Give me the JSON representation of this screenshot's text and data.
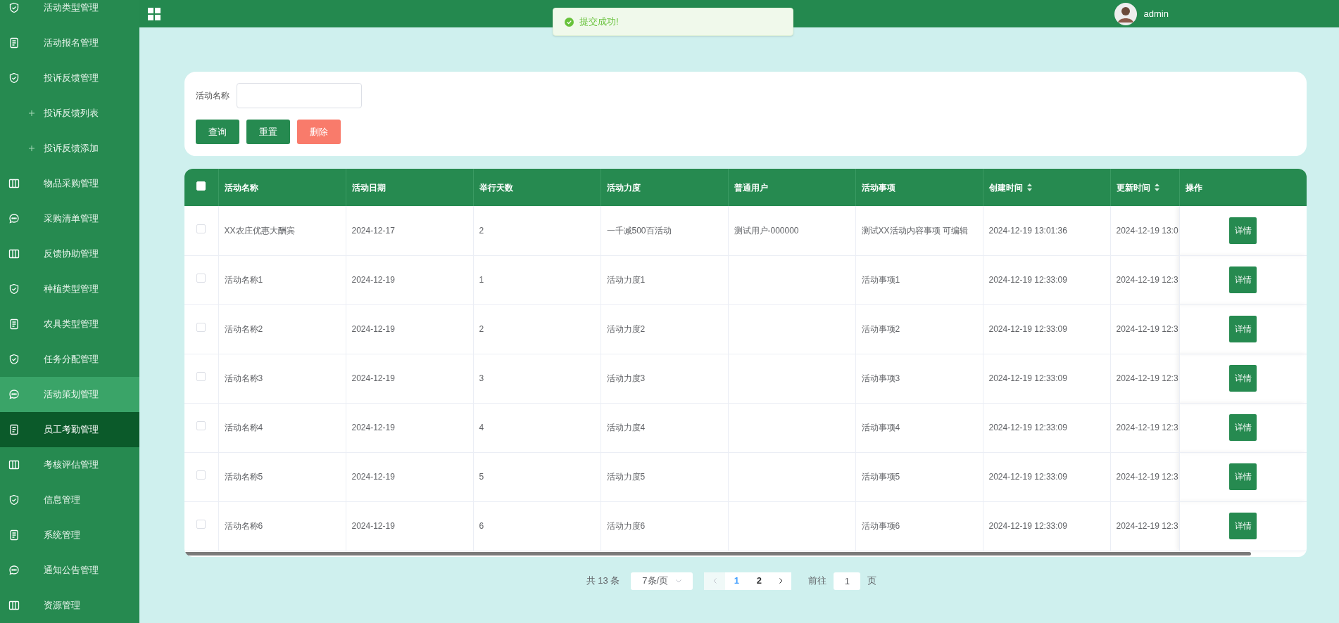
{
  "header": {
    "user": "admin"
  },
  "toast": {
    "message": "提交成功!"
  },
  "sidebar": {
    "items": [
      {
        "kind": "shield",
        "label": "活动类型管理",
        "selected": false,
        "hovered": false
      },
      {
        "kind": "doc",
        "label": "活动报名管理",
        "selected": false,
        "hovered": false
      },
      {
        "kind": "shield",
        "label": "投诉反馈管理",
        "selected": false,
        "hovered": false
      },
      {
        "kind": "sub",
        "label": "投诉反馈列表",
        "selected": false,
        "hovered": false
      },
      {
        "kind": "sub",
        "label": "投诉反馈添加",
        "selected": false,
        "hovered": false
      },
      {
        "kind": "columns",
        "label": "物品采购管理",
        "selected": false,
        "hovered": false
      },
      {
        "kind": "chat",
        "label": "采购清单管理",
        "selected": false,
        "hovered": false
      },
      {
        "kind": "columns",
        "label": "反馈协助管理",
        "selected": false,
        "hovered": false
      },
      {
        "kind": "shield",
        "label": "种植类型管理",
        "selected": false,
        "hovered": false
      },
      {
        "kind": "doc",
        "label": "农具类型管理",
        "selected": false,
        "hovered": false
      },
      {
        "kind": "shield",
        "label": "任务分配管理",
        "selected": false,
        "hovered": false
      },
      {
        "kind": "chat",
        "label": "活动策划管理",
        "selected": false,
        "hovered": true
      },
      {
        "kind": "doc",
        "label": "员工考勤管理",
        "selected": true,
        "hovered": false
      },
      {
        "kind": "columns",
        "label": "考核评估管理",
        "selected": false,
        "hovered": false
      },
      {
        "kind": "shield",
        "label": "信息管理",
        "selected": false,
        "hovered": false
      },
      {
        "kind": "doc",
        "label": "系统管理",
        "selected": false,
        "hovered": false
      },
      {
        "kind": "chat",
        "label": "通知公告管理",
        "selected": false,
        "hovered": false
      },
      {
        "kind": "columns",
        "label": "资源管理",
        "selected": false,
        "hovered": false
      }
    ]
  },
  "search": {
    "label": "活动名称",
    "buttons": [
      {
        "label": "查询",
        "kind": "primary"
      },
      {
        "label": "重置",
        "kind": "primary"
      },
      {
        "label": "删除",
        "kind": "danger"
      }
    ]
  },
  "table": {
    "select_all": {
      "checked": false
    },
    "columns": [
      {
        "label": "活动名称",
        "sortable": false
      },
      {
        "label": "活动日期",
        "sortable": false
      },
      {
        "label": "举行天数",
        "sortable": false
      },
      {
        "label": "活动力度",
        "sortable": false
      },
      {
        "label": "普通用户",
        "sortable": false
      },
      {
        "label": "活动事项",
        "sortable": false
      },
      {
        "label": "创建时间",
        "sortable": true
      },
      {
        "label": "更新时间",
        "sortable": true
      },
      {
        "label": "操作",
        "sortable": false
      }
    ],
    "rows": [
      {
        "checked": false,
        "cells": [
          "XX农庄优惠大酬宾",
          "2024-12-17",
          "2",
          "一千减500百活动",
          "测试用户-000000",
          "测试XX活动内容事项 可编辑",
          "2024-12-19 13:01:36",
          "2024-12-19 13:0"
        ],
        "action": "详情"
      },
      {
        "checked": false,
        "cells": [
          "活动名称1",
          "2024-12-19",
          "1",
          "活动力度1",
          "",
          "活动事项1",
          "2024-12-19 12:33:09",
          "2024-12-19 12:3"
        ],
        "action": "详情"
      },
      {
        "checked": false,
        "cells": [
          "活动名称2",
          "2024-12-19",
          "2",
          "活动力度2",
          "",
          "活动事项2",
          "2024-12-19 12:33:09",
          "2024-12-19 12:3"
        ],
        "action": "详情"
      },
      {
        "checked": false,
        "cells": [
          "活动名称3",
          "2024-12-19",
          "3",
          "活动力度3",
          "",
          "活动事项3",
          "2024-12-19 12:33:09",
          "2024-12-19 12:3"
        ],
        "action": "详情"
      },
      {
        "checked": false,
        "cells": [
          "活动名称4",
          "2024-12-19",
          "4",
          "活动力度4",
          "",
          "活动事项4",
          "2024-12-19 12:33:09",
          "2024-12-19 12:3"
        ],
        "action": "详情"
      },
      {
        "checked": false,
        "cells": [
          "活动名称5",
          "2024-12-19",
          "5",
          "活动力度5",
          "",
          "活动事项5",
          "2024-12-19 12:33:09",
          "2024-12-19 12:3"
        ],
        "action": "详情"
      },
      {
        "checked": false,
        "cells": [
          "活动名称6",
          "2024-12-19",
          "6",
          "活动力度6",
          "",
          "活动事项6",
          "2024-12-19 12:33:09",
          "2024-12-19 12:3"
        ],
        "action": "详情"
      }
    ]
  },
  "pagination": {
    "total": "共 13 条",
    "page_size": "7条/页",
    "pages": [
      {
        "label": "1",
        "selected": true
      },
      {
        "label": "2",
        "selected": false
      }
    ],
    "goto_label": "前往",
    "goto_value": "1",
    "page_suffix": "页"
  }
}
